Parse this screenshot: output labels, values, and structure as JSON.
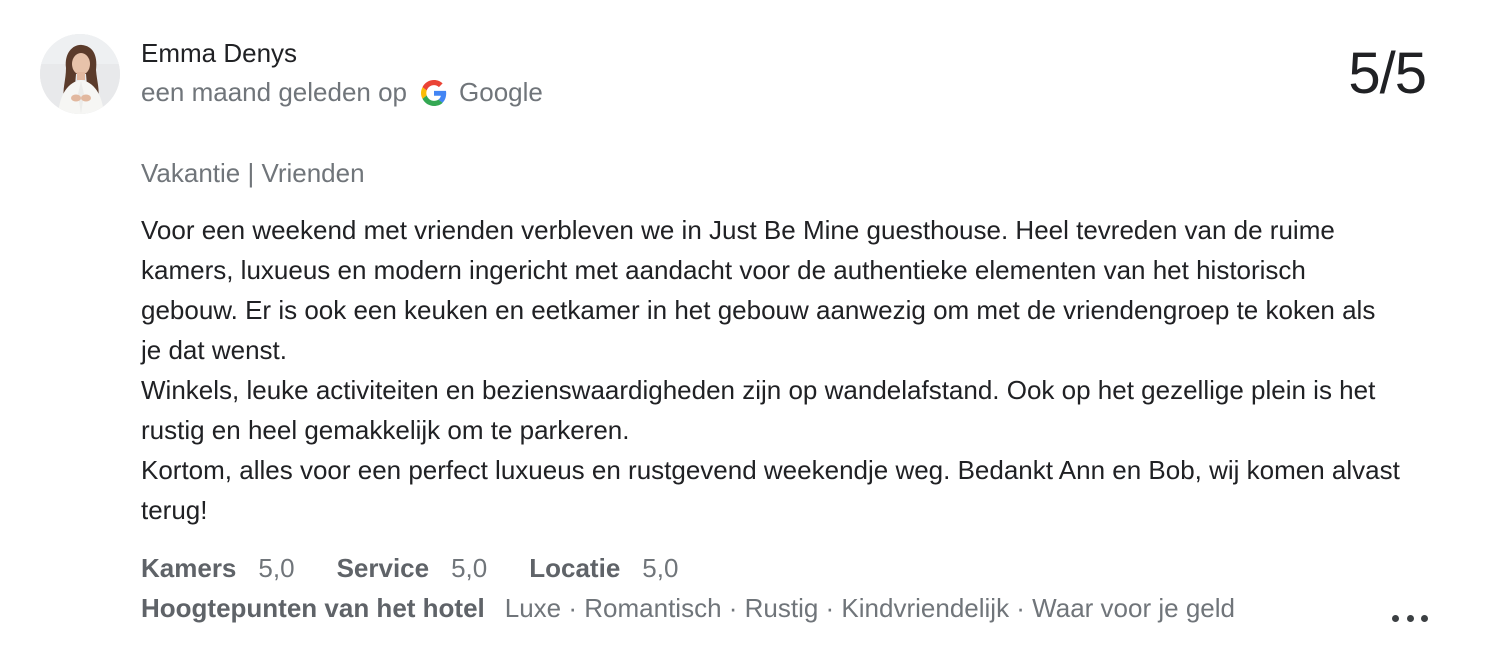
{
  "review": {
    "author": "Emma Denys",
    "time": "een maand geleden op",
    "source": "Google",
    "source_icon": "google-g-icon",
    "score": "5/5",
    "trip_type": "Vakantie | Vrienden",
    "paragraphs": [
      "Voor een weekend met vrienden verbleven we in Just Be Mine guesthouse. Heel tevreden van de ruime kamers, luxueus en modern ingericht met aandacht voor de authentieke elementen van het historisch gebouw. Er is ook een keuken en eetkamer in het gebouw aanwezig om met de vriendengroep te koken als je dat wenst.",
      "Winkels, leuke activiteiten en bezienswaardigheden zijn op wandelafstand. Ook op het gezellige plein is het rustig en heel gemakkelijk om te parkeren.",
      "Kortom, alles voor een perfect luxueus en rustgevend weekendje weg. Bedankt Ann en Bob, wij komen alvast terug!"
    ],
    "ratings": [
      {
        "label": "Kamers",
        "value": "5,0"
      },
      {
        "label": "Service",
        "value": "5,0"
      },
      {
        "label": "Locatie",
        "value": "5,0"
      }
    ],
    "highlights_label": "Hoogtepunten van het hotel",
    "highlights": "Luxe · Romantisch · Rustig · Kindvriendelijk · Waar voor je geld",
    "more_icon": "more-horizontal-icon"
  },
  "colors": {
    "primary_text": "#202124",
    "secondary_text": "#70757a",
    "google_blue": "#4285F4",
    "google_red": "#EA4335",
    "google_yellow": "#FBBC05",
    "google_green": "#34A853"
  }
}
